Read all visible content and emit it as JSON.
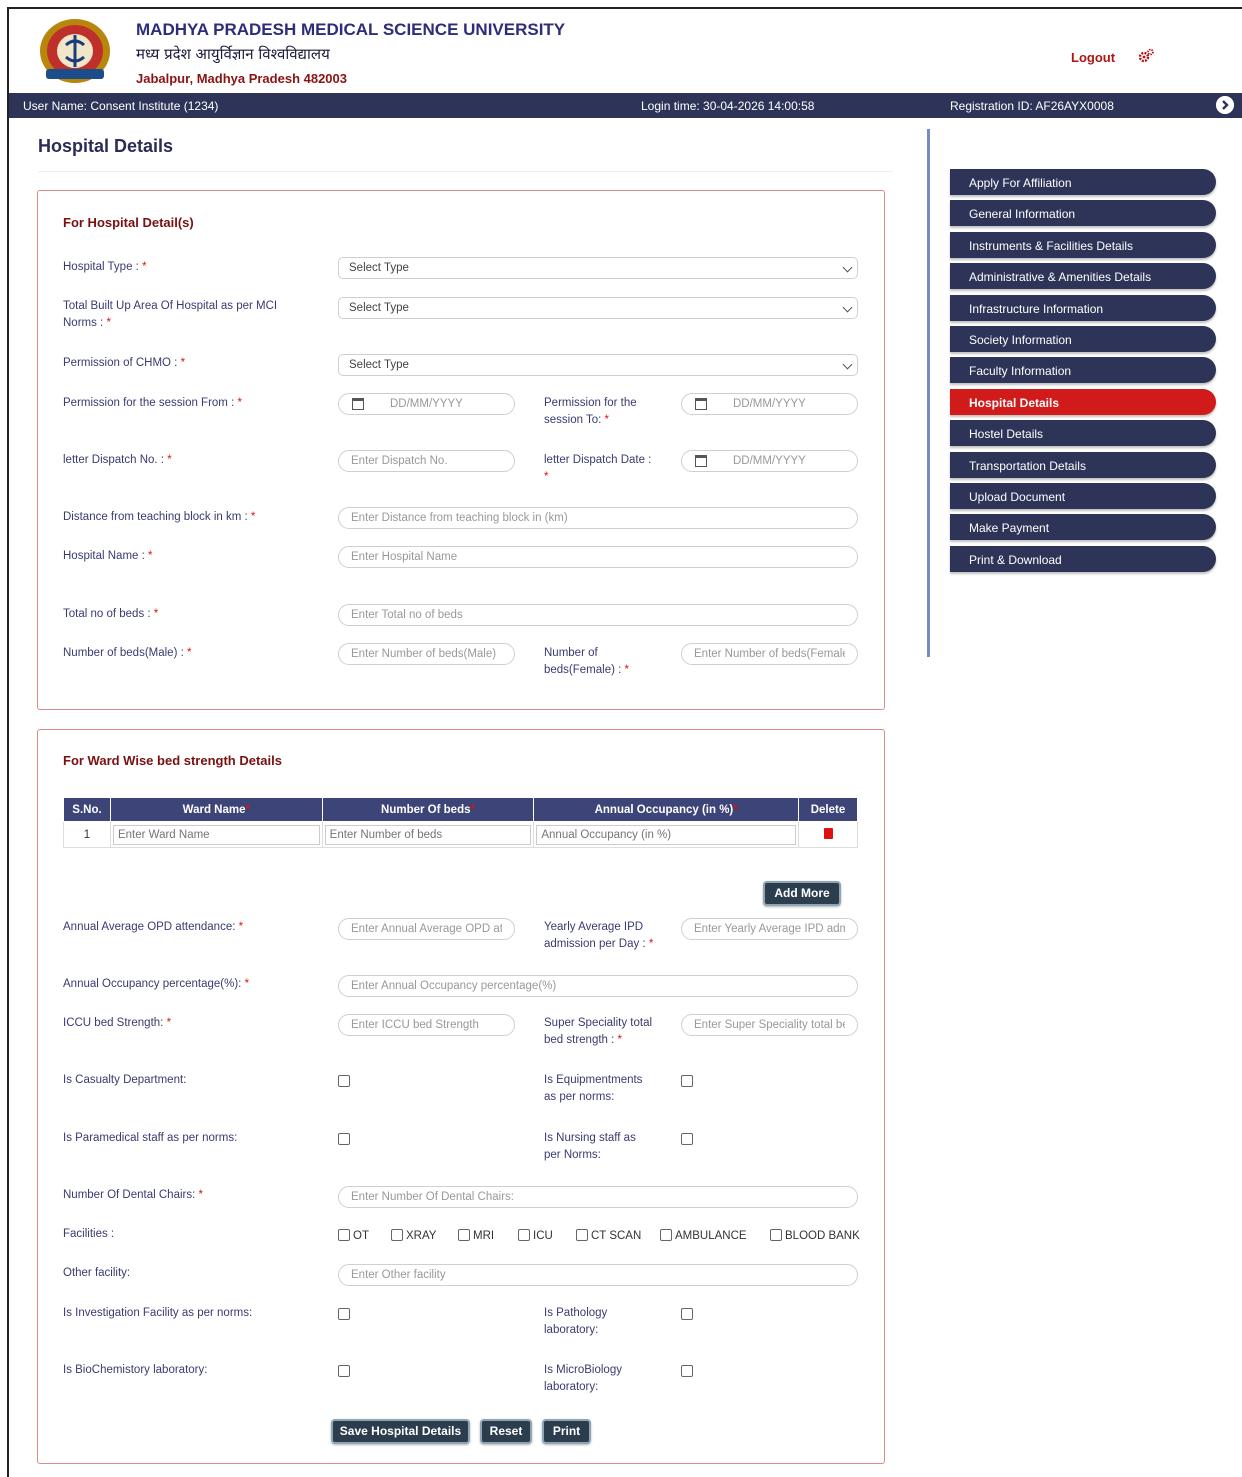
{
  "header": {
    "title_en": "MADHYA PRADESH MEDICAL SCIENCE UNIVERSITY",
    "title_hi": "मध्य प्रदेश आयुर्विज्ञान विश्वविद्यालय",
    "address": "Jabalpur, Madhya Pradesh 482003",
    "logout_label": "Logout"
  },
  "topbar": {
    "user": "User Name: Consent Institute (1234)",
    "login_time": "Login time: 30-04-2026 14:00:58",
    "registration": "Registration ID: AF26AYX0008"
  },
  "page_title": "Hospital Details",
  "hospital_section": {
    "title": "For Hospital Detail(s)",
    "hospital_type_label": "Hospital Type :",
    "hospital_type_value": "Select Type",
    "built_area_label": "Total Built Up Area Of Hospital as per MCI Norms :",
    "built_area_value": "Select Type",
    "chmo_label": "Permission of CHMO :",
    "chmo_value": "Select Type",
    "session_from_label": "Permission for the session From :",
    "session_to_label": "Permission for the session To:",
    "date_placeholder": "DD/MM/YYYY",
    "dispatch_no_label": "letter Dispatch No. :",
    "dispatch_no_placeholder": "Enter Dispatch No.",
    "dispatch_date_label": "letter Dispatch Date :",
    "distance_label": "Distance from teaching block in km :",
    "distance_placeholder": "Enter Distance from teaching block in (km)",
    "hospital_name_label": "Hospital Name :",
    "hospital_name_placeholder": "Enter Hospital Name",
    "beds_label": "Total no of beds :",
    "beds_placeholder": "Enter Total no of beds",
    "beds_male_label": "Number of beds(Male) :",
    "beds_male_placeholder": "Enter Number of beds(Male)",
    "beds_female_label": "Number of beds(Female) :",
    "beds_female_placeholder": "Enter Number of beds(Female"
  },
  "ward_section": {
    "title": "For Ward Wise bed strength Details",
    "columns": [
      "S.No.",
      "Ward Name",
      "Number Of beds",
      "Annual Occupancy (in %)",
      "Delete"
    ],
    "row_sno": "1",
    "ward_placeholder": "Enter Ward Name",
    "beds_placeholder": "Enter Number of beds",
    "occupancy_placeholder": "Annual Occupancy (in %)",
    "add_more_label": "Add More",
    "opd_label": "Annual Average OPD attendance:",
    "opd_placeholder": "Enter Annual Average OPD att",
    "ipd_label": "Yearly Average IPD admission per Day :",
    "ipd_placeholder": "Enter Yearly Average IPD admi",
    "occ_pct_label": "Annual Occupancy percentage(%):",
    "occ_pct_placeholder": "Enter Annual Occupancy percentage(%)",
    "iccu_label": "ICCU bed Strength:",
    "iccu_placeholder": "Enter ICCU bed Strength",
    "super_label": "Super Speciality total bed strength :",
    "super_placeholder": "Enter Super Speciality total be",
    "casualty_label": "Is Casualty Department:",
    "equip_label": "Is Equipmentments as per norms:",
    "paramedical_label": "Is Paramedical staff as per norms:",
    "nursing_label": "Is Nursing staff as per Norms:",
    "dental_label": "Number Of Dental Chairs:",
    "dental_placeholder": "Enter Number Of Dental Chairs:",
    "facilities_label": "Facilities :",
    "facilities": [
      "OT",
      "XRAY",
      "MRI",
      "ICU",
      "CT SCAN",
      "AMBULANCE",
      "BLOOD BANK"
    ],
    "other_label": "Other facility:",
    "other_placeholder": "Enter Other facility",
    "investigation_label": "Is Investigation Facility as per norms:",
    "pathology_label": "Is Pathology laboratory:",
    "biochem_label": "Is BioChemistory laboratory:",
    "micro_label": "Is MicroBiology laboratory:"
  },
  "actions": {
    "save_label": "Save Hospital Details",
    "reset_label": "Reset",
    "print_label": "Print"
  },
  "sidebar": {
    "items": [
      "Apply For Affiliation",
      "General Information",
      "Instruments & Facilities Details",
      "Administrative & Amenities Details",
      "Infrastructure Information",
      "Society Information",
      "Faculty Information",
      "Hospital Details",
      "Hostel Details",
      "Transportation Details",
      "Upload Document",
      "Make Payment",
      "Print & Download"
    ],
    "active_index": 7
  },
  "colors": {
    "nav": "#2e3458",
    "active": "#d11a1a",
    "section_title": "#7a1010",
    "table_header": "#3d4478"
  },
  "icons": [
    "university-logo",
    "gear-icon",
    "arrow-right-icon",
    "calendar-icon",
    "trash-icon",
    "chevron-down-icon"
  ]
}
